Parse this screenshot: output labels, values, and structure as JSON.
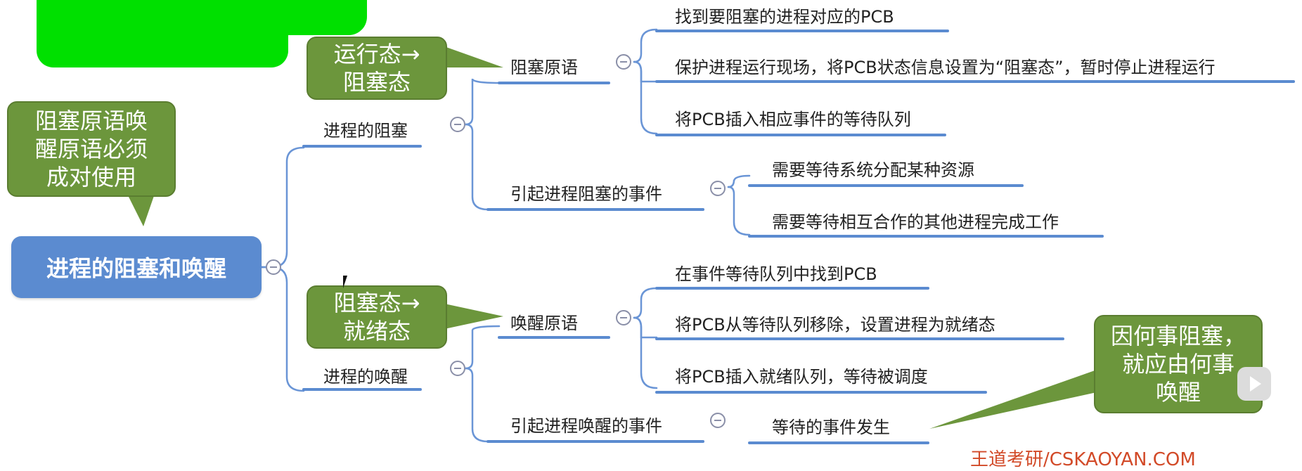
{
  "mindmap": {
    "root": "进程的阻塞和唤醒",
    "branches": [
      {
        "label": "进程的阻塞",
        "children": [
          {
            "label": "阻塞原语",
            "items": [
              "找到要阻塞的进程对应的PCB",
              "保护进程运行现场，将PCB状态信息设置为“阻塞态”，暂时停止进程运行",
              "将PCB插入相应事件的等待队列"
            ]
          },
          {
            "label": "引起进程阻塞的事件",
            "items": [
              "需要等待系统分配某种资源",
              "需要等待相互合作的其他进程完成工作"
            ]
          }
        ]
      },
      {
        "label": "进程的唤醒",
        "children": [
          {
            "label": "唤醒原语",
            "items": [
              "在事件等待队列中找到PCB",
              "将PCB从等待队列移除，设置进程为就绪态",
              "将PCB插入就绪队列，等待被调度"
            ]
          },
          {
            "label": "引起进程唤醒的事件",
            "items": [
              "等待的事件发生"
            ]
          }
        ]
      }
    ]
  },
  "notes": {
    "pair_line1": "阻塞原语唤",
    "pair_line2": "醒原语必须",
    "pair_line3": "成对使用",
    "block_line1": "运行态→",
    "block_line2": "阻塞态",
    "wake_line1": "阻塞态→",
    "wake_line2": "就绪态",
    "cause_line1": "因何事阻塞，",
    "cause_line2": "就应由何事",
    "cause_line3": "唤醒"
  },
  "watermark": "王道考研/CSKAOYAN.COM",
  "colors": {
    "root_fill": "#5b8bd0",
    "underline": "#5b8bd0",
    "connector": "#6a95d6",
    "note_fill": "#6c963c",
    "highlight": "#00e000",
    "watermark": "#d24a28"
  }
}
